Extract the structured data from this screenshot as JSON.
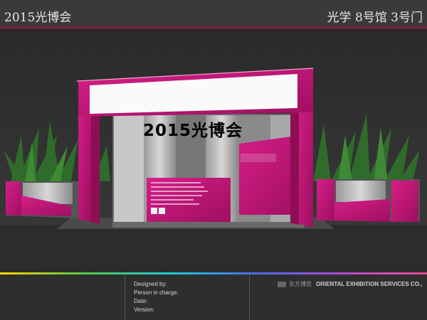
{
  "header": {
    "title": "2015光博会",
    "location": "光学  8号馆  3号门"
  },
  "booth": {
    "sign_text": "2015光博会",
    "accent_color": "#c8197c"
  },
  "footer": {
    "labels": [
      "Designed by:",
      "Person in charge:",
      "Date:",
      "Version:"
    ],
    "company_cn": "东方博览",
    "company_en": "ORIENTAL EXHIBITION SERVICES CO.,"
  }
}
